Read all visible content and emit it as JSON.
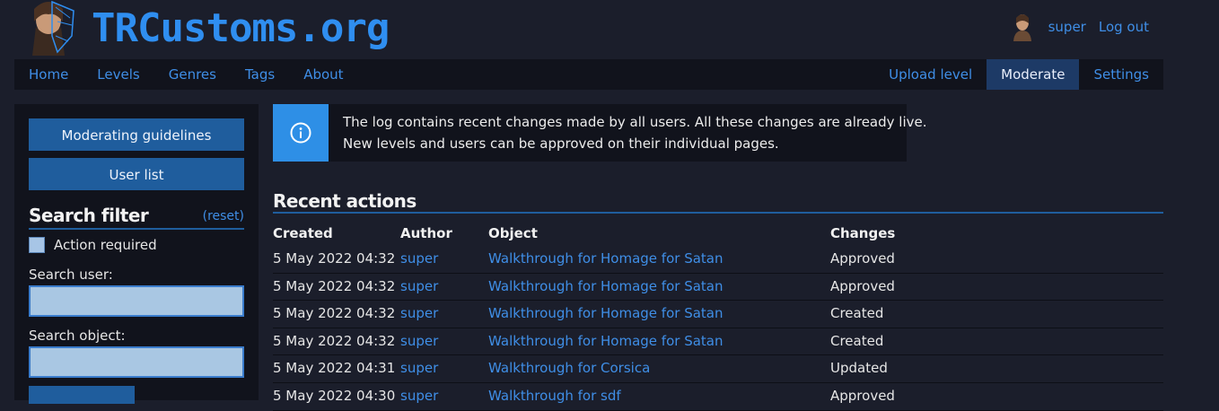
{
  "header": {
    "site_title": "TRCustoms.org",
    "username": "super",
    "logout_label": "Log out"
  },
  "nav": {
    "left": [
      "Home",
      "Levels",
      "Genres",
      "Tags",
      "About"
    ],
    "right": [
      "Upload level",
      "Moderate",
      "Settings"
    ],
    "active": "Moderate"
  },
  "sidebar": {
    "guidelines_button": "Moderating guidelines",
    "user_list_button": "User list",
    "filter_title": "Search filter",
    "reset_label": "(reset)",
    "action_required_label": "Action required",
    "action_required_checked": false,
    "search_user_label": "Search user:",
    "search_user_value": "",
    "search_object_label": "Search object:",
    "search_object_value": ""
  },
  "info": {
    "icon": "info-circle-icon",
    "line1": "The log contains recent changes made by all users. All these changes are already live.",
    "line2": "New levels and users can be approved on their individual pages."
  },
  "recent": {
    "title": "Recent actions",
    "columns": [
      "Created",
      "Author",
      "Object",
      "Changes"
    ],
    "rows": [
      {
        "created": "5 May 2022 04:32",
        "author": "super",
        "object": "Walkthrough for Homage for Satan",
        "changes": "Approved"
      },
      {
        "created": "5 May 2022 04:32",
        "author": "super",
        "object": "Walkthrough for Homage for Satan",
        "changes": "Approved"
      },
      {
        "created": "5 May 2022 04:32",
        "author": "super",
        "object": "Walkthrough for Homage for Satan",
        "changes": "Created"
      },
      {
        "created": "5 May 2022 04:32",
        "author": "super",
        "object": "Walkthrough for Homage for Satan",
        "changes": "Created"
      },
      {
        "created": "5 May 2022 04:31",
        "author": "super",
        "object": "Walkthrough for Corsica",
        "changes": "Updated"
      },
      {
        "created": "5 May 2022 04:30",
        "author": "super",
        "object": "Walkthrough for sdf",
        "changes": "Approved"
      }
    ]
  },
  "colors": {
    "background": "#1b1e2b",
    "panel": "#11131c",
    "accent": "#2f8ef0",
    "button": "#1f5d9d",
    "link": "#3f8ee6"
  }
}
